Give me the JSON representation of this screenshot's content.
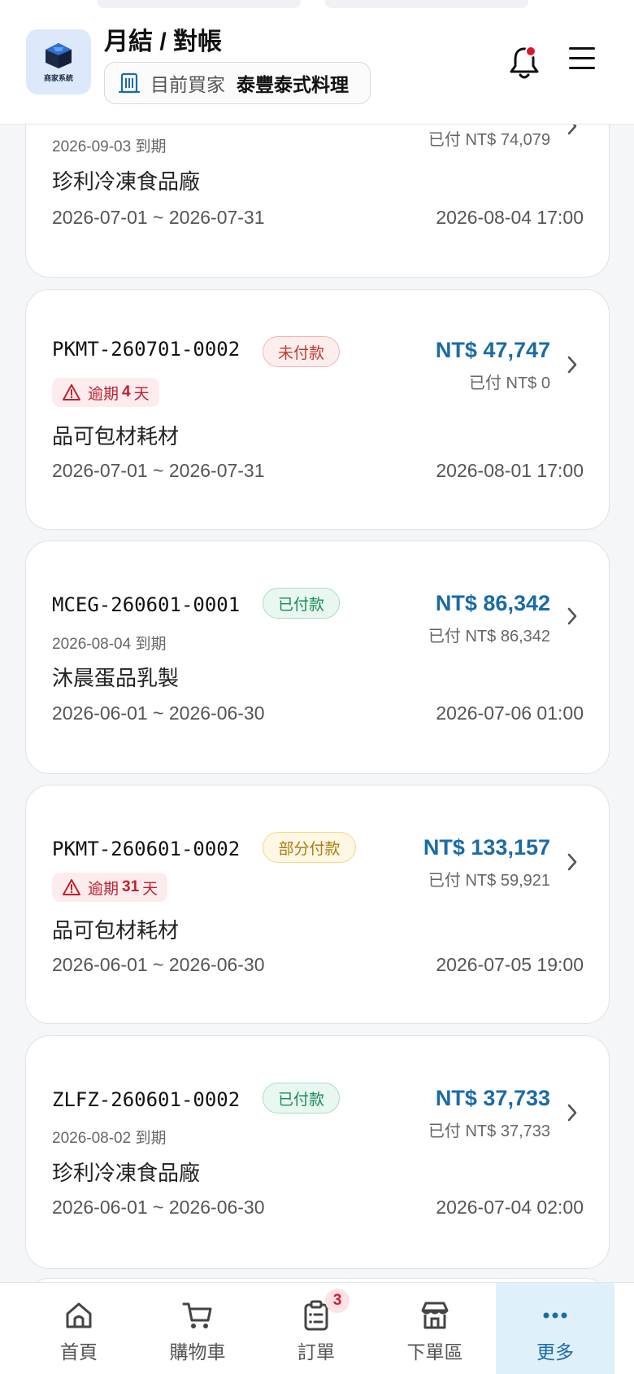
{
  "header": {
    "logo_text": "商家系統",
    "title": "月結 / 對帳",
    "buyer_label": "目前買家",
    "buyer_name": "泰豐泰式料理"
  },
  "invoices": [
    {
      "due": "2026-09-03 到期",
      "vendor": "珍利冷凍食品廠",
      "period": "2026-07-01 ~ 2026-07-31",
      "created": "2026-08-04 17:00",
      "paid_text": "已付 NT$ 74,079"
    },
    {
      "number": "PKMT-260701-0002",
      "status": "未付款",
      "overdue_prefix": "逾期",
      "overdue_days": "4",
      "overdue_suffix": "天",
      "vendor": "品可包材耗材",
      "period": "2026-07-01 ~ 2026-07-31",
      "created": "2026-08-01 17:00",
      "amount": "NT$ 47,747",
      "paid_text": "已付 NT$ 0"
    },
    {
      "number": "MCEG-260601-0001",
      "status": "已付款",
      "due": "2026-08-04 到期",
      "vendor": "沐晨蛋品乳製",
      "period": "2026-06-01 ~ 2026-06-30",
      "created": "2026-07-06 01:00",
      "amount": "NT$ 86,342",
      "paid_text": "已付 NT$ 86,342"
    },
    {
      "number": "PKMT-260601-0002",
      "status": "部分付款",
      "overdue_prefix": "逾期",
      "overdue_days": "31",
      "overdue_suffix": "天",
      "vendor": "品可包材耗材",
      "period": "2026-06-01 ~ 2026-06-30",
      "created": "2026-07-05 19:00",
      "amount": "NT$ 133,157",
      "paid_text": "已付 NT$ 59,921"
    },
    {
      "number": "ZLFZ-260601-0002",
      "status": "已付款",
      "due": "2026-08-02 到期",
      "vendor": "珍利冷凍食品廠",
      "period": "2026-06-01 ~ 2026-06-30",
      "created": "2026-07-04 02:00",
      "amount": "NT$ 37,733",
      "paid_text": "已付 NT$ 37,733"
    }
  ],
  "nav": {
    "home": "首頁",
    "cart": "購物車",
    "orders": "訂單",
    "orders_badge": "3",
    "shop": "下單區",
    "more": "更多"
  },
  "colors": {
    "accent": "#1a6ba8",
    "danger": "#c0202e",
    "paid": "#1a8a55",
    "partial": "#b07a12"
  }
}
